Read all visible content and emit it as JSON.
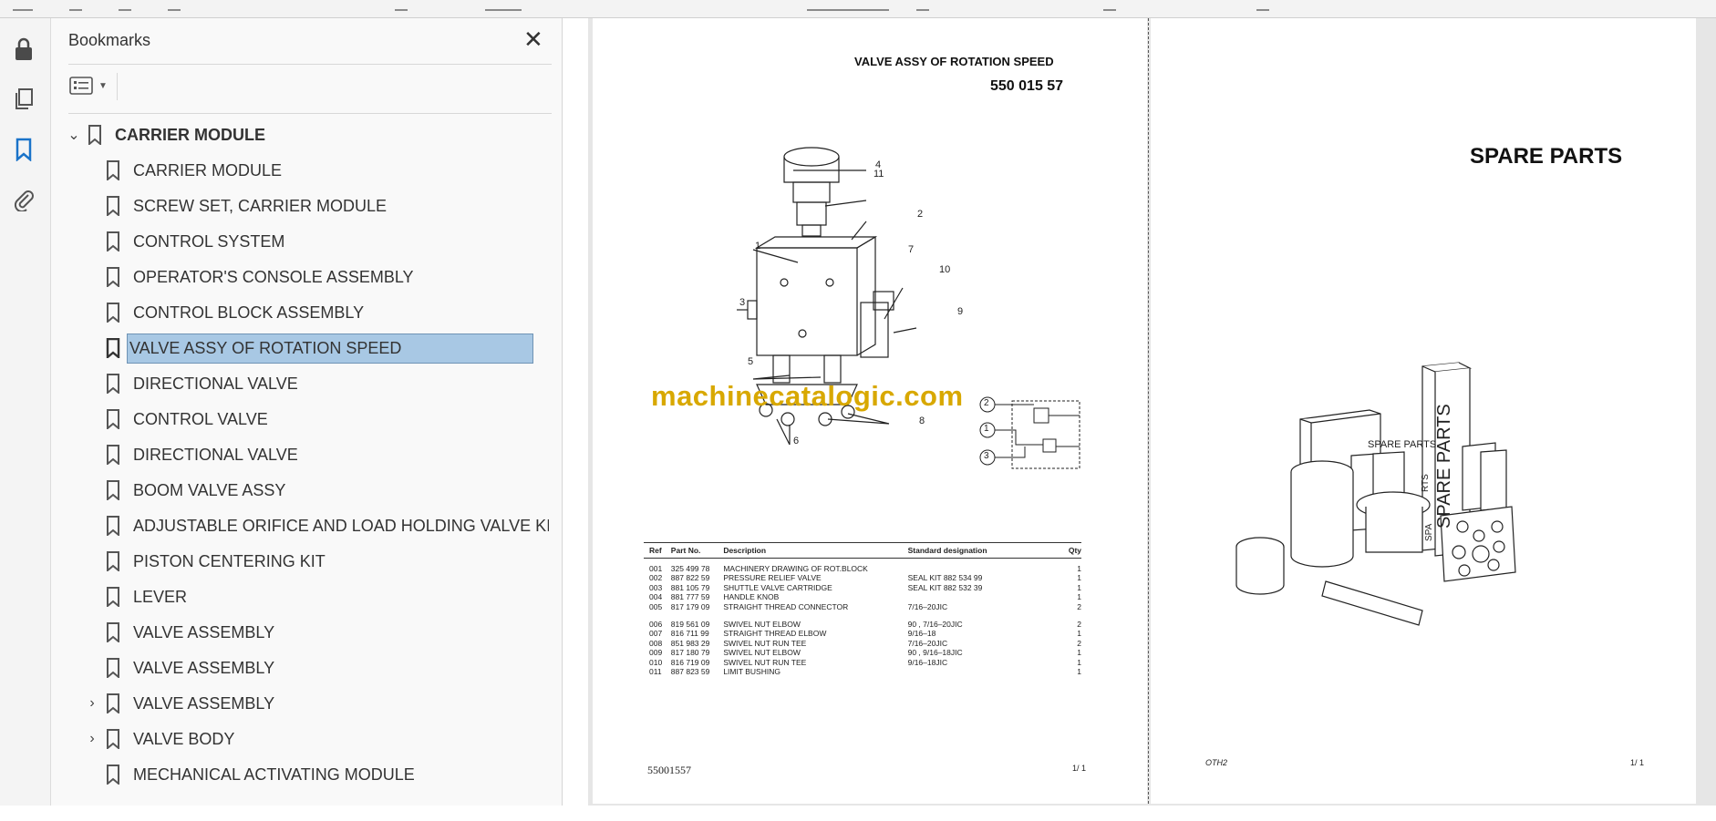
{
  "panel": {
    "title": "Bookmarks",
    "close_label": "✕"
  },
  "bookmarks": [
    {
      "label": "CARRIER MODULE",
      "level": 0,
      "expander": "down"
    },
    {
      "label": "CARRIER MODULE",
      "level": 1
    },
    {
      "label": "SCREW SET, CARRIER MODULE",
      "level": 1
    },
    {
      "label": "CONTROL SYSTEM",
      "level": 1
    },
    {
      "label": "OPERATOR'S CONSOLE ASSEMBLY",
      "level": 1
    },
    {
      "label": "CONTROL BLOCK ASSEMBLY",
      "level": 1
    },
    {
      "label": "VALVE ASSY OF ROTATION SPEED",
      "level": 1,
      "selected": true
    },
    {
      "label": "DIRECTIONAL VALVE",
      "level": 1
    },
    {
      "label": "CONTROL VALVE",
      "level": 1
    },
    {
      "label": "DIRECTIONAL VALVE",
      "level": 1
    },
    {
      "label": "BOOM VALVE ASSY",
      "level": 1
    },
    {
      "label": "ADJUSTABLE ORIFICE AND LOAD HOLDING VALVE KIT",
      "level": 1
    },
    {
      "label": "PISTON CENTERING KIT",
      "level": 1
    },
    {
      "label": "LEVER",
      "level": 1
    },
    {
      "label": "VALVE ASSEMBLY",
      "level": 1
    },
    {
      "label": "VALVE ASSEMBLY",
      "level": 1
    },
    {
      "label": "VALVE ASSEMBLY",
      "level": 1,
      "expander": "right"
    },
    {
      "label": "VALVE BODY",
      "level": 1,
      "expander": "right"
    },
    {
      "label": "MECHANICAL ACTIVATING MODULE",
      "level": 1
    }
  ],
  "page1": {
    "title": "VALVE ASSY OF ROTATION SPEED",
    "number": "550 015 57",
    "watermark": "machinecatalogic.com",
    "callouts": [
      "4",
      "11",
      "2",
      "1",
      "7",
      "10",
      "3",
      "9",
      "5",
      "8",
      "6"
    ],
    "schematic_labels": [
      "2",
      "1",
      "3"
    ],
    "table_headers": {
      "ref": "Ref",
      "part": "Part No.",
      "desc": "Description",
      "std": "Standard designation",
      "qty": "Qty"
    },
    "rows_a": [
      {
        "ref": "001",
        "part": "325 499 78",
        "desc": "MACHINERY DRAWING OF ROT.BLOCK",
        "std": "",
        "qty": "1"
      },
      {
        "ref": "002",
        "part": "887 822 59",
        "desc": "PRESSURE RELIEF VALVE",
        "std": "SEAL KIT  882 534 99",
        "qty": "1"
      },
      {
        "ref": "003",
        "part": "881 105 79",
        "desc": "SHUTTLE VALVE CARTRIDGE",
        "std": "SEAL KIT  882 532 39",
        "qty": "1"
      },
      {
        "ref": "004",
        "part": "881 777 59",
        "desc": "HANDLE KNOB",
        "std": "",
        "qty": "1"
      },
      {
        "ref": "005",
        "part": "817 179 09",
        "desc": "STRAIGHT THREAD CONNECTOR",
        "std": "7/16–20JIC",
        "qty": "2"
      }
    ],
    "rows_b": [
      {
        "ref": "006",
        "part": "819 561 09",
        "desc": "SWIVEL NUT ELBOW",
        "std": "90 , 7/16–20JIC",
        "qty": "2"
      },
      {
        "ref": "007",
        "part": "816 711 99",
        "desc": "STRAIGHT THREAD ELBOW",
        "std": "9/16–18",
        "qty": "1"
      },
      {
        "ref": "008",
        "part": "851 983 29",
        "desc": "SWIVEL NUT RUN TEE",
        "std": "7/16–20JIC",
        "qty": "2"
      },
      {
        "ref": "009",
        "part": "817 180 79",
        "desc": "SWIVEL NUT ELBOW",
        "std": "90 , 9/16–18JIC",
        "qty": "1"
      },
      {
        "ref": "010",
        "part": "816 719 09",
        "desc": "SWIVEL NUT RUN TEE",
        "std": "9/16–18JIC",
        "qty": "1"
      },
      {
        "ref": "011",
        "part": "887 823 59",
        "desc": "LIMIT BUSHING",
        "std": "",
        "qty": "1"
      }
    ],
    "footer_left": "55001557",
    "footer_right": "1/  1"
  },
  "page2": {
    "title": "SPARE PARTS",
    "box_label_1": "SPARE PARTS",
    "box_label_2": "SPARE PARTS",
    "box_label_3": "RTS",
    "box_label_4": "SPA",
    "footer_left": "OTH2",
    "footer_right": "1/  1"
  }
}
